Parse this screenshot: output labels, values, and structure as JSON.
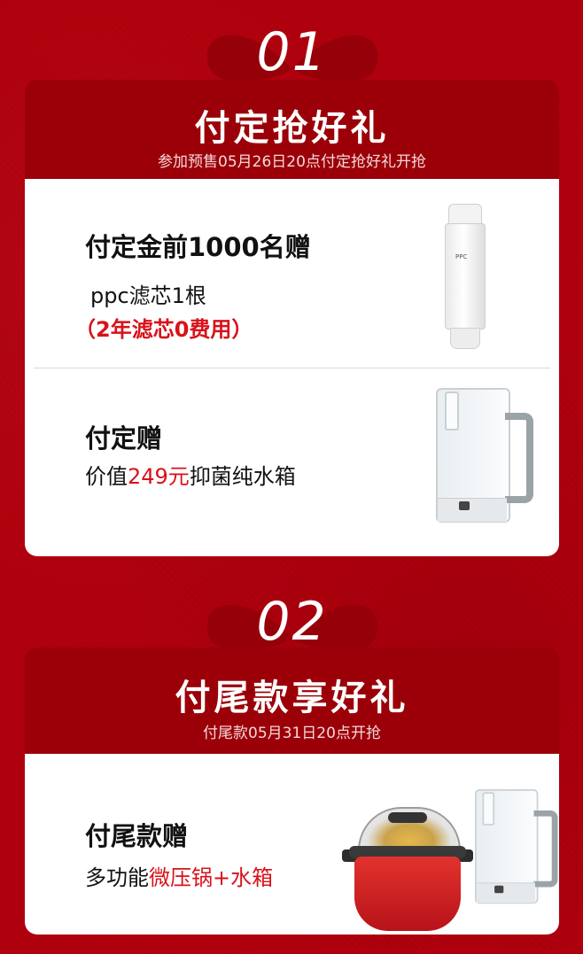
{
  "colors": {
    "background": "#b1000d",
    "band": "#9b0008",
    "accent_red": "#d8121a"
  },
  "section1": {
    "number": "01",
    "title": "付定抢好礼",
    "subtitle": "参加预售05月26日20点付定抢好礼开抢",
    "item1": {
      "heading": "付定金前1000名赠",
      "line1": "ppc滤芯1根",
      "note": "（2年滤芯0费用）",
      "image_icon": "ppc-filter-cartridge",
      "filter_label": "PPC"
    },
    "item2": {
      "heading": "付定赠",
      "line_prefix": "价值",
      "line_price": "249元",
      "line_suffix": "抑菌纯水箱",
      "image_icon": "water-tank"
    }
  },
  "section2": {
    "number": "02",
    "title": "付尾款享好礼",
    "subtitle": "付尾款05月31日20点开抢",
    "item1": {
      "heading": "付尾款赠",
      "line_prefix": "多功能",
      "line_highlight": "微压锅+水箱",
      "image_icons": [
        "pressure-pot",
        "water-tank"
      ]
    }
  }
}
